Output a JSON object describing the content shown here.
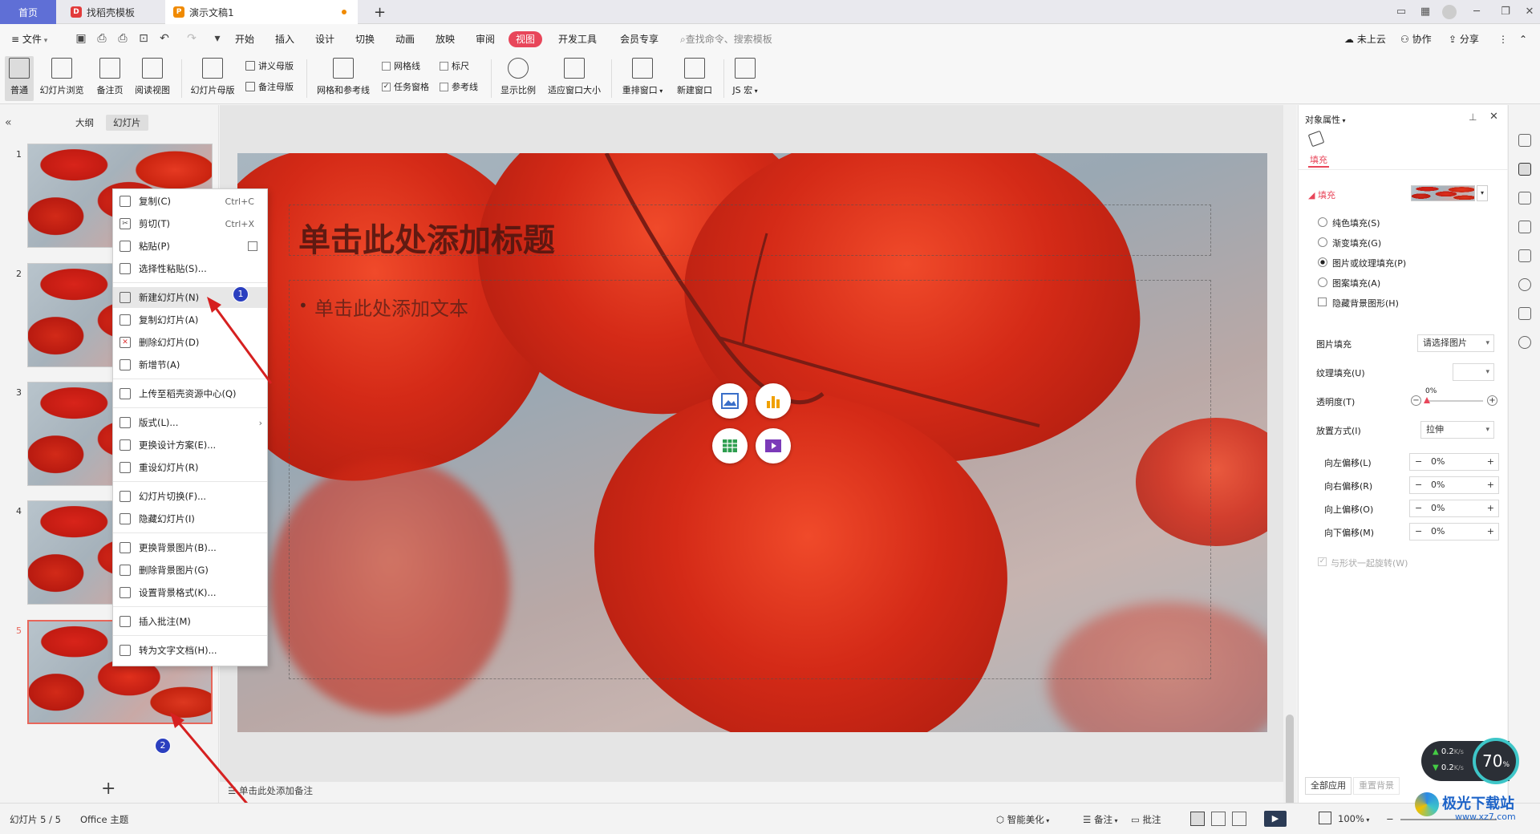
{
  "tabs": {
    "home": "首页",
    "template": "找稻壳模板",
    "doc": "演示文稿1",
    "new_tab": "+"
  },
  "menubar": {
    "file": "文件",
    "items": [
      "开始",
      "插入",
      "设计",
      "切换",
      "动画",
      "放映",
      "审阅",
      "视图",
      "开发工具",
      "会员专享"
    ],
    "active": "视图",
    "search_placeholder": "查找命令、搜索模板",
    "cloud": "未上云",
    "collab": "协作",
    "share": "分享"
  },
  "ribbon": {
    "normal": "普通",
    "sorter": "幻灯片浏览",
    "notes_page": "备注页",
    "reading": "阅读视图",
    "slide_master": "幻灯片母版",
    "handout_master": "讲义母版",
    "notes_master": "备注母版",
    "grid_guides": "网格和参考线",
    "gridlines": "网格线",
    "ruler": "标尺",
    "task_pane": "任务窗格",
    "guides": "参考线",
    "zoom": "显示比例",
    "fit_window": "适应窗口大小",
    "arrange": "重排窗口",
    "new_window": "新建窗口",
    "js_macro": "JS 宏"
  },
  "leftpane": {
    "outline_tab": "大纲",
    "slides_tab": "幻灯片",
    "slide_numbers": [
      "1",
      "2",
      "3",
      "4",
      "5"
    ],
    "add_label": "+"
  },
  "context_menu": {
    "copy": "复制(C)",
    "copy_sc": "Ctrl+C",
    "cut": "剪切(T)",
    "cut_sc": "Ctrl+X",
    "paste": "粘贴(P)",
    "paste_special": "选择性粘贴(S)...",
    "new_slide": "新建幻灯片(N)",
    "dup_slide": "复制幻灯片(A)",
    "del_slide": "删除幻灯片(D)",
    "new_section": "新增节(A)",
    "upload": "上传至稻壳资源中心(Q)",
    "layout": "版式(L)...",
    "change_design": "更换设计方案(E)...",
    "reset_slide": "重设幻灯片(R)",
    "transition": "幻灯片切换(F)...",
    "hide_slide": "隐藏幻灯片(I)",
    "change_bg": "更换背景图片(B)...",
    "del_bg": "删除背景图片(G)",
    "bg_format": "设置背景格式(K)...",
    "insert_comment": "插入批注(M)",
    "to_doc": "转为文字文档(H)...",
    "badge1": "1",
    "badge2": "2"
  },
  "slide": {
    "title_placeholder": "单击此处添加标题",
    "body_placeholder": "单击此处添加文本",
    "notes_placeholder": "单击此处添加备注"
  },
  "props": {
    "header": "对象属性",
    "fill_tab": "填充",
    "fill_section": "填充",
    "solid": "纯色填充(S)",
    "gradient": "渐变填充(G)",
    "picture": "图片或纹理填充(P)",
    "pattern": "图案填充(A)",
    "hide_bg": "隐藏背景图形(H)",
    "pic_fill_label": "图片填充",
    "pic_fill_value": "请选择图片",
    "texture_label": "纹理填充(U)",
    "transparency_label": "透明度(T)",
    "transparency_value": "0%",
    "transparency": 0,
    "placement_label": "放置方式(I)",
    "placement_value": "拉伸",
    "off_left": "向左偏移(L)",
    "off_right": "向右偏移(R)",
    "off_up": "向上偏移(O)",
    "off_down": "向下偏移(M)",
    "off_value": "0%",
    "rotate": "与形状一起旋转(W)",
    "apply_all": "全部应用",
    "reset_bg": "重置背景"
  },
  "status": {
    "slide_count": "幻灯片 5 / 5",
    "theme": "Office 主题",
    "beautify": "智能美化",
    "notes": "备注",
    "comments": "批注",
    "zoom": "100%",
    "speed_up": "0.2",
    "speed_down": "0.2",
    "speed_unit": "K/s",
    "perf": "70",
    "perf_unit": "%",
    "watermark": "极光下载站",
    "watermark_url": "www.xz7.com"
  },
  "colors": {
    "accent": "#e8465a",
    "tab_active_icon": "#f08a00",
    "leaf_red": "#d42a17"
  }
}
